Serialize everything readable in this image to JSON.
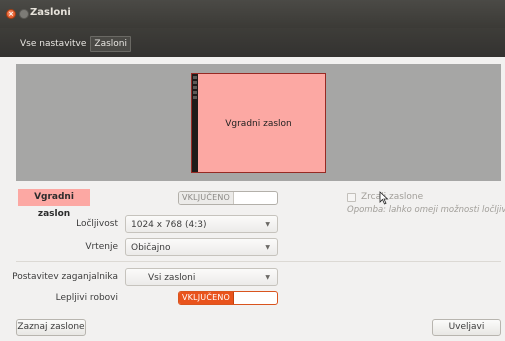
{
  "window": {
    "title": "Zasloni"
  },
  "breadcrumbs": [
    {
      "label": "Vse nastavitve"
    },
    {
      "label": "Zasloni"
    }
  ],
  "preview": {
    "monitor_label": "Vgradni zaslon"
  },
  "display": {
    "name": "Vgradni zaslon",
    "power_toggle": {
      "label": "VKLJUČENO",
      "state": "off"
    },
    "mirror": {
      "label": "Zrcali zaslone",
      "checked": false,
      "enabled": false
    },
    "note": "Opomba: lahko omeji možnosti ločljivosti"
  },
  "fields": {
    "resolution": {
      "label": "Ločljivost",
      "value": "1024 x 768 (4:3)"
    },
    "rotation": {
      "label": "Vrtenje",
      "value": "Običajno"
    },
    "launcher_placement": {
      "label": "Postavitev zaganjalnika",
      "value": "Vsi zasloni"
    },
    "sticky_edges": {
      "label": "Lepljivi robovi",
      "toggle_label": "VKLJUČENO",
      "state": "on"
    }
  },
  "buttons": {
    "detect": "Zaznaj zaslone",
    "apply": "Uveljavi"
  },
  "colors": {
    "accent": "#e9531c",
    "monitor_fill": "#fca8a3",
    "titlebar": "#3c3b37"
  }
}
